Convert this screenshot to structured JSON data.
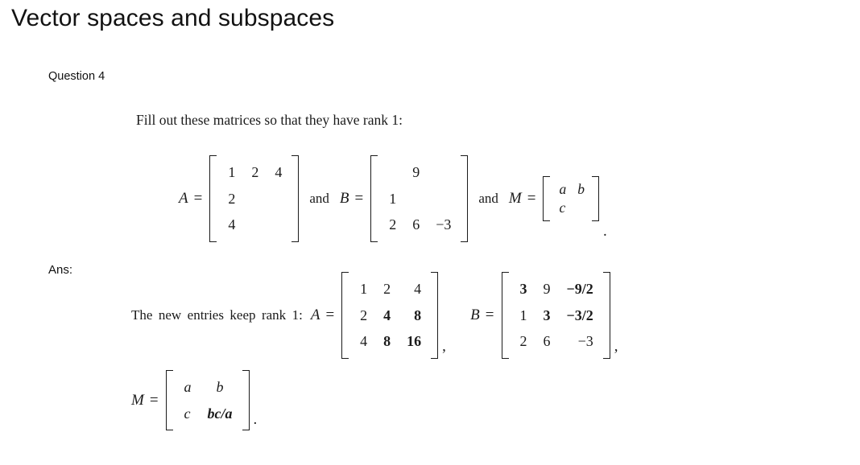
{
  "page": {
    "title": "Vector spaces and subspaces",
    "question_label": "Question 4",
    "answer_label": "Ans:",
    "prompt": "Fill out these matrices so that they have rank 1:"
  },
  "symbols": {
    "equals": "=",
    "and": "and",
    "comma": ",",
    "period": ".",
    "label_A": "A",
    "label_B": "B",
    "label_M": "M"
  },
  "problem": {
    "matrix_A": {
      "name": "A",
      "rows": [
        [
          "1",
          "2",
          "4"
        ],
        [
          "2",
          "",
          ""
        ],
        [
          "4",
          "",
          ""
        ]
      ]
    },
    "matrix_B": {
      "name": "B",
      "rows": [
        [
          "",
          "9",
          ""
        ],
        [
          "1",
          "",
          ""
        ],
        [
          "2",
          "6",
          "−3"
        ]
      ]
    },
    "matrix_M": {
      "name": "M",
      "rows": [
        [
          "a",
          "b"
        ],
        [
          "c",
          ""
        ]
      ]
    }
  },
  "answer": {
    "lead_text": "The new entries keep rank 1:",
    "matrix_A": {
      "name": "A",
      "rows": [
        [
          "1",
          "2",
          "4"
        ],
        [
          "2",
          "4",
          "8"
        ],
        [
          "4",
          "8",
          "16"
        ]
      ],
      "bold_cells": [
        [
          1,
          1
        ],
        [
          1,
          2
        ],
        [
          2,
          1
        ],
        [
          2,
          2
        ]
      ]
    },
    "matrix_B": {
      "name": "B",
      "rows": [
        [
          "3",
          "9",
          "−9/2"
        ],
        [
          "1",
          "3",
          "−3/2"
        ],
        [
          "2",
          "6",
          "−3"
        ]
      ],
      "bold_cells": [
        [
          0,
          0
        ],
        [
          0,
          2
        ],
        [
          1,
          1
        ],
        [
          1,
          2
        ]
      ]
    },
    "matrix_M": {
      "name": "M",
      "rows": [
        [
          "a",
          "b"
        ],
        [
          "c",
          "bc/a"
        ]
      ],
      "bold_cells": [
        [
          1,
          1
        ]
      ]
    }
  }
}
